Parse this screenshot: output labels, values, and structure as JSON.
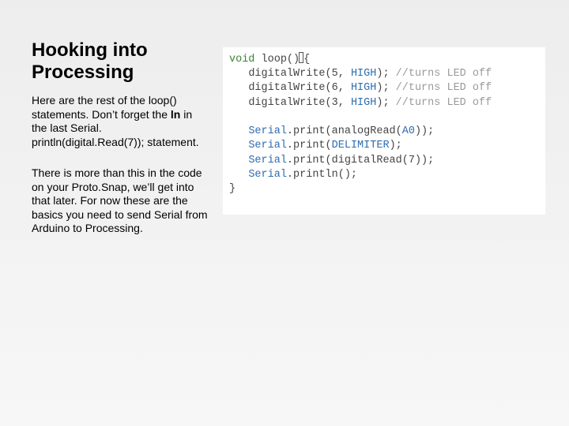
{
  "slide": {
    "heading": "Hooking into Processing",
    "para1": {
      "a": "Here are the rest of the loop() statements.  Don’t forget the ",
      "bold": "ln",
      "b": " in the last Serial. println(digital.Read(7)); statement."
    },
    "para2": "There is more than this in the code on your Proto.Snap, we’ll get into that later. For now these are the basics you need to send Serial from Arduino to Processing."
  },
  "code": {
    "l1": {
      "kw": "void",
      "fn": "loop",
      "paren": "()",
      "brace": "{"
    },
    "l2": {
      "call": "digitalWrite(5, ",
      "const": "HIGH",
      "end": ");",
      "com": "//turns LED off"
    },
    "l3": {
      "call": "digitalWrite(6, ",
      "const": "HIGH",
      "end": ");",
      "com": "//turns LED off"
    },
    "l4": {
      "call": "digitalWrite(3, ",
      "const": "HIGH",
      "end": ");",
      "com": "//turns LED off"
    },
    "l6": {
      "obj": "Serial",
      "mid": ".print(analogRead(",
      "arg": "A0",
      "end": "));"
    },
    "l7": {
      "obj": "Serial",
      "mid": ".print(",
      "arg": "DELIMITER",
      "end": ");"
    },
    "l8": {
      "obj": "Serial",
      "rest": ".print(digitalRead(7));"
    },
    "l9": {
      "obj": "Serial",
      "rest": ".println();"
    },
    "l10": "}"
  }
}
